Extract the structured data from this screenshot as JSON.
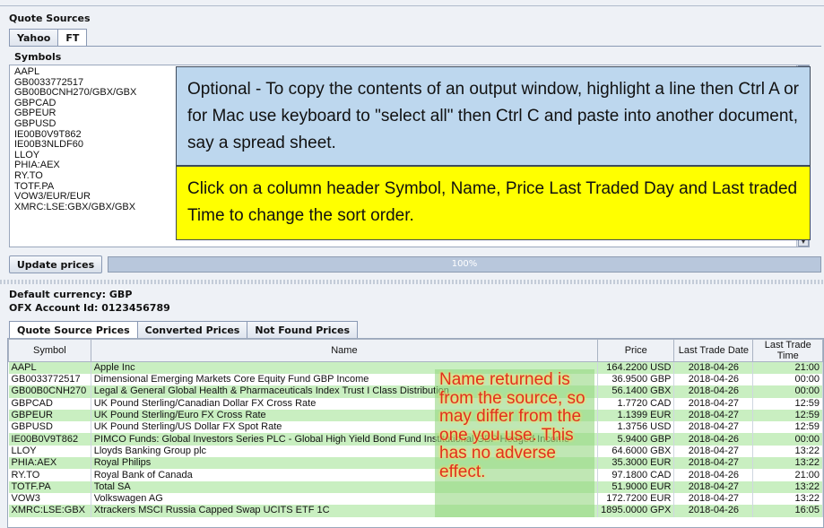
{
  "quote_sources_title": "Quote Sources",
  "source_tabs": [
    "Yahoo",
    "FT"
  ],
  "symbols_label": "Symbols",
  "symbols": [
    "AAPL",
    "GB0033772517",
    "GB00B0CNH270/GBX/GBX",
    "GBPCAD",
    "GBPEUR",
    "GBPUSD",
    "IE00B0V9T862",
    "IE00B3NLDF60",
    "LLOY",
    "PHIA:AEX",
    "RY.TO",
    "TOTF.PA",
    "VOW3/EUR/EUR",
    "XMRC:LSE:GBX/GBX/GBX"
  ],
  "callout_blue": "Optional - To copy the contents of an output window, highlight a line then Ctrl A or for Mac use keyboard to \"select all\" then Ctrl C and paste into another document, say a spread sheet.",
  "callout_yellow": "Click on a column header Symbol, Name, Price Last Traded Day and Last traded Time to change the sort order.",
  "update_button": "Update prices",
  "progress_text": "100%",
  "progress_value": 1.0,
  "default_currency": "Default currency: GBP",
  "ofx_account": "OFX Account Id: 0123456789",
  "result_tabs": [
    "Quote Source Prices",
    "Converted Prices",
    "Not Found Prices"
  ],
  "table": {
    "headers": [
      "Symbol",
      "Name",
      "Price",
      "Last Trade Date",
      "Last Trade Time"
    ],
    "rows": [
      [
        "AAPL",
        "Apple Inc",
        "164.2200 USD",
        "2018-04-26",
        "21:00"
      ],
      [
        "GB0033772517",
        "Dimensional Emerging Markets Core Equity Fund GBP Income",
        "36.9500 GBP",
        "2018-04-26",
        "00:00"
      ],
      [
        "GB00B0CNH270",
        "Legal & General Global Health & Pharmaceuticals Index Trust I Class Distribution",
        "56.1400 GBX",
        "2018-04-26",
        "00:00"
      ],
      [
        "GBPCAD",
        "UK Pound Sterling/Canadian Dollar FX Cross Rate",
        "1.7720 CAD",
        "2018-04-27",
        "12:59"
      ],
      [
        "GBPEUR",
        "UK Pound Sterling/Euro FX Cross Rate",
        "1.1399 EUR",
        "2018-04-27",
        "12:59"
      ],
      [
        "GBPUSD",
        "UK Pound Sterling/US Dollar FX Spot Rate",
        "1.3756 USD",
        "2018-04-27",
        "12:59"
      ],
      [
        "IE00B0V9T862",
        "PIMCO Funds: Global Investors Series PLC - Global High Yield Bond Fund Institutional GBP Hedged Income",
        "5.9400 GBP",
        "2018-04-26",
        "00:00"
      ],
      [
        "LLOY",
        "Lloyds Banking Group plc",
        "64.6000 GBX",
        "2018-04-27",
        "13:22"
      ],
      [
        "PHIA:AEX",
        "Royal Philips",
        "35.3000 EUR",
        "2018-04-27",
        "13:22"
      ],
      [
        "RY.TO",
        "Royal Bank of Canada",
        "97.1800 CAD",
        "2018-04-26",
        "21:00"
      ],
      [
        "TOTF.PA",
        "Total SA",
        "51.9000 EUR",
        "2018-04-27",
        "13:22"
      ],
      [
        "VOW3",
        "Volkswagen AG",
        "172.7200 EUR",
        "2018-04-27",
        "13:22"
      ],
      [
        "XMRC:LSE:GBX",
        "Xtrackers MSCI Russia Capped Swap UCITS ETF 1C",
        "1895.0000 GPX",
        "2018-04-26",
        "16:05"
      ]
    ]
  },
  "name_callout": "Name returned is from the source, so may differ from the one you use. This has no adverse effect.",
  "colors": {
    "row_green": "#c9efc1",
    "callout_blue": "#bdd7ee",
    "callout_yellow": "#ffff00",
    "callout_red_text": "#e0301e"
  }
}
